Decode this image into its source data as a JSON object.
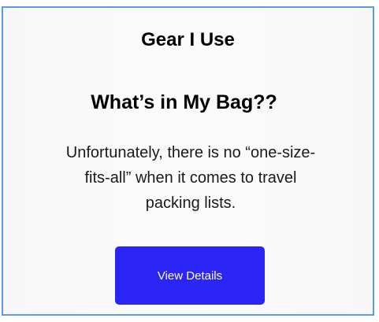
{
  "section": {
    "title": "Gear I Use"
  },
  "card": {
    "title": "What’s in My Bag??",
    "description": "Unfortunately, there is no “one-size-fits-all” when it comes to travel packing lists.",
    "button_label": "View Details"
  },
  "colors": {
    "border": "#5c9be0",
    "button": "#2b26f5",
    "button_text": "#ffffff"
  }
}
